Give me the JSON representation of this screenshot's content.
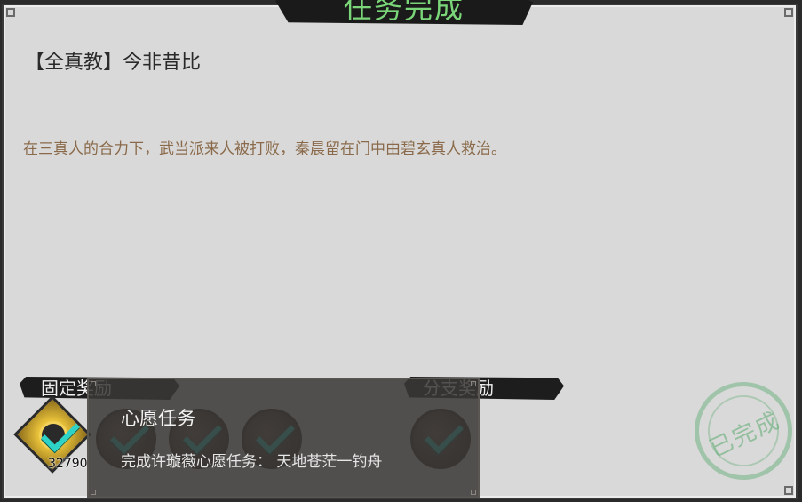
{
  "header": {
    "title": "任务完成"
  },
  "quest": {
    "title": "【全真教】今非昔比",
    "description": "在三真人的合力下，武当派来人被打败，秦晨留在门中由碧玄真人救治。"
  },
  "rewards": {
    "fixed_label": "固定奖励",
    "branch_label": "分支奖励",
    "currency_count": "32790",
    "items": [
      {
        "icon": "gold-coin-icon"
      },
      {
        "icon": "dark-orb-icon"
      },
      {
        "icon": "dark-orb-icon"
      },
      {
        "icon": "dark-orb-icon"
      },
      {
        "icon": "dark-orb-icon"
      }
    ]
  },
  "stamp": {
    "text": "已完成"
  },
  "tooltip": {
    "title": "心愿任务",
    "body": "完成许璇薇心愿任务：  天地苍茫一钓舟"
  },
  "colors": {
    "title_green": "#7bd67a",
    "check_teal": "#2ed3c8",
    "desc_brown": "#8a6a4a"
  }
}
